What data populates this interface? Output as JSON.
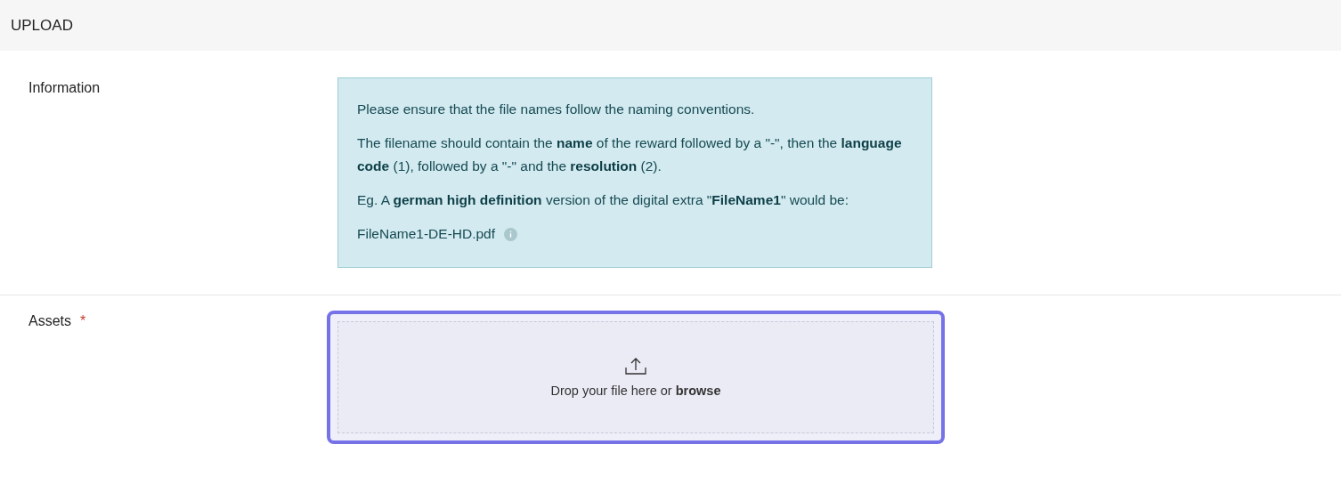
{
  "header": {
    "title": "UPLOAD"
  },
  "sections": [
    {
      "kind": "info",
      "label": "Information",
      "paragraphs": [
        "Please ensure that the file names follow the naming conventions.",
        "The filename should contain the **name** of the reward followed by a \"-\", then the **language code** (1), followed by a \"-\" and the **resolution** (2).",
        "Eg. A **german high definition** version of the digital extra \"**FileName1**\" would be:"
      ],
      "example": "FileName1-DE-HD.pdf"
    },
    {
      "kind": "dropzone",
      "label": "Assets",
      "required_marker": "*",
      "focused": true,
      "prompt": "Drop your file here or **browse**"
    }
  ]
}
